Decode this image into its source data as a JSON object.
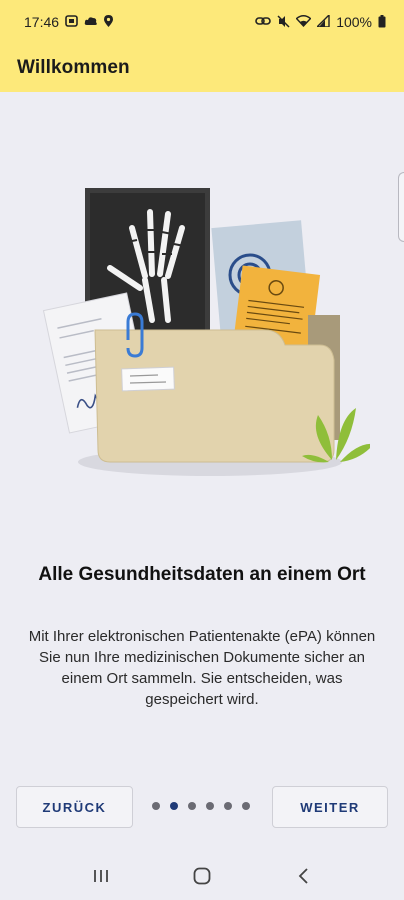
{
  "status_bar": {
    "time": "17:46",
    "battery": "100%",
    "left_icons": [
      "sim-icon",
      "cloud-icon",
      "location-icon"
    ],
    "right_icons": [
      "link-icon",
      "mute-icon",
      "wifi-icon",
      "signal-icon",
      "battery-icon"
    ]
  },
  "app_bar": {
    "title": "Willkommen"
  },
  "onboarding": {
    "headline": "Alle Gesundheitsdaten an einem Ort",
    "description": "Mit Ihrer elektronischen Patientenakte (ePA) können Sie nun Ihre medizinischen Dokumente sicher an einem Ort sammeln. Sie entscheiden, was gespeichert wird."
  },
  "navigation": {
    "back_label": "ZURÜCK",
    "next_label": "WEITER",
    "page_count": 6,
    "current_page": 2
  },
  "colors": {
    "app_bar": "#fde97a",
    "background": "#ededf3",
    "accent": "#1f3a77",
    "dot_inactive": "#6b6b73"
  },
  "system_nav": [
    "recent-apps-icon",
    "home-icon",
    "back-icon"
  ]
}
